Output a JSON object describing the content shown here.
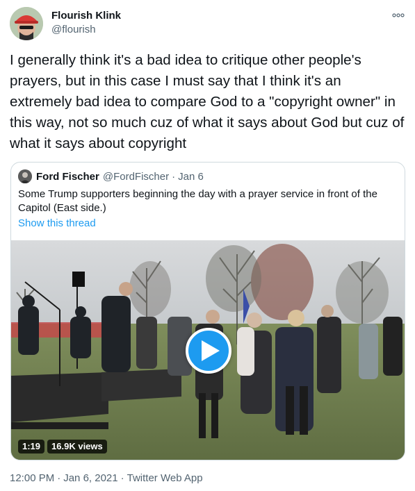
{
  "author": {
    "name": "Flourish Klink",
    "handle": "@flourish",
    "avatar_icon": "avatar-red-cap-icon"
  },
  "tweet": {
    "text": "I generally think it's a bad idea to critique other people's prayers, but in this case I must say that I think it's an extremely bad idea to compare God to a \"copyright owner\" in this way, not so much cuz of what it says about God but cuz of what it says about copyright"
  },
  "quote": {
    "name": "Ford Fischer",
    "handle": "@FordFischer",
    "separator": "·",
    "date": "Jan 6",
    "text": "Some Trump supporters beginning the day with a prayer service in front of the Capitol (East side.)",
    "show_thread": "Show this thread",
    "video": {
      "duration": "1:19",
      "views": "16.9K views",
      "play_icon": "play-icon"
    }
  },
  "footer": {
    "time": "12:00 PM",
    "separator": "·",
    "date": "Jan 6, 2021",
    "source": "Twitter Web App"
  },
  "colors": {
    "accent": "#1d9bf0",
    "text": "#0f1419",
    "muted": "#536471",
    "border": "#cfd9de"
  }
}
